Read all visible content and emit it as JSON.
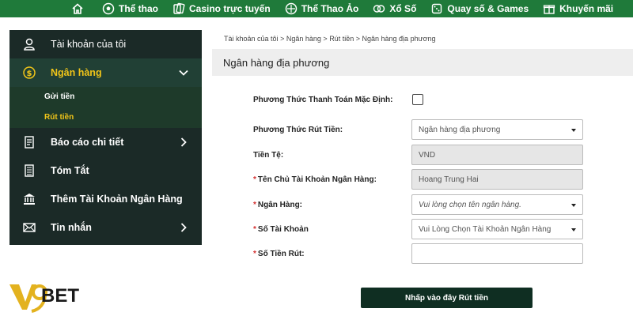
{
  "topnav": {
    "items": [
      {
        "label": "",
        "icon": "home-icon"
      },
      {
        "label": "Thể thao",
        "icon": "soccer-ball-icon"
      },
      {
        "label": "Casino trực tuyến",
        "icon": "casino-cards-icon"
      },
      {
        "label": "Thể Thao Ảo",
        "icon": "virtual-sport-icon"
      },
      {
        "label": "Xổ Số",
        "icon": "lottery-icon"
      },
      {
        "label": "Quay số & Games",
        "icon": "dice-icon"
      },
      {
        "label": "Khuyến mãi",
        "icon": "gift-icon"
      }
    ],
    "color": "#1f7a3a"
  },
  "sidebar": {
    "items": [
      {
        "label": "Tài khoản của tôi",
        "icon": "user-icon"
      },
      {
        "label": "Ngân hàng",
        "icon": "dollar-coin-icon"
      },
      {
        "label": "Báo cáo chi tiết",
        "icon": "report-icon"
      },
      {
        "label": "Tóm Tắt",
        "icon": "summary-icon"
      },
      {
        "label": "Thêm Tài Khoản Ngân Hàng",
        "icon": "bank-icon"
      },
      {
        "label": "Tin nhắn",
        "icon": "mail-icon"
      }
    ],
    "sub_items": [
      {
        "label": "Gửi tiền"
      },
      {
        "label": "Rút tiền"
      }
    ],
    "active_color": "#f0c419"
  },
  "breadcrumb": [
    "Tài khoản của tôi",
    "Ngân hàng",
    "Rút tiền",
    "Ngân hàng địa phương"
  ],
  "breadcrumb_sep": ">",
  "page_title": "Ngân hàng địa phương",
  "form": {
    "default_method_label": "Phương Thức Thanh Toán Mặc Định:",
    "withdraw_method_label": "Phương Thức Rút Tiền:",
    "withdraw_method_value": "Ngân hàng địa phương",
    "currency_label": "Tiền Tệ:",
    "currency_value": "VND",
    "account_holder_label": "Tên Chủ Tài Khoản Ngân Hàng:",
    "account_holder_value": "Hoang Trung Hai",
    "bank_label": "Ngân Hàng:",
    "bank_placeholder": "Vui lòng chọn tên ngân hàng.",
    "account_number_label": "Số Tài Khoản",
    "account_number_placeholder": "Vui Lòng Chọn Tài Khoản Ngân Hàng",
    "amount_label": "Số Tiền Rút:",
    "amount_value": "",
    "required_mark": "*"
  },
  "submit_label": "Nhấp vào đây Rút tiền",
  "logo": {
    "text": "BET",
    "icon": "v9-logo-icon"
  }
}
